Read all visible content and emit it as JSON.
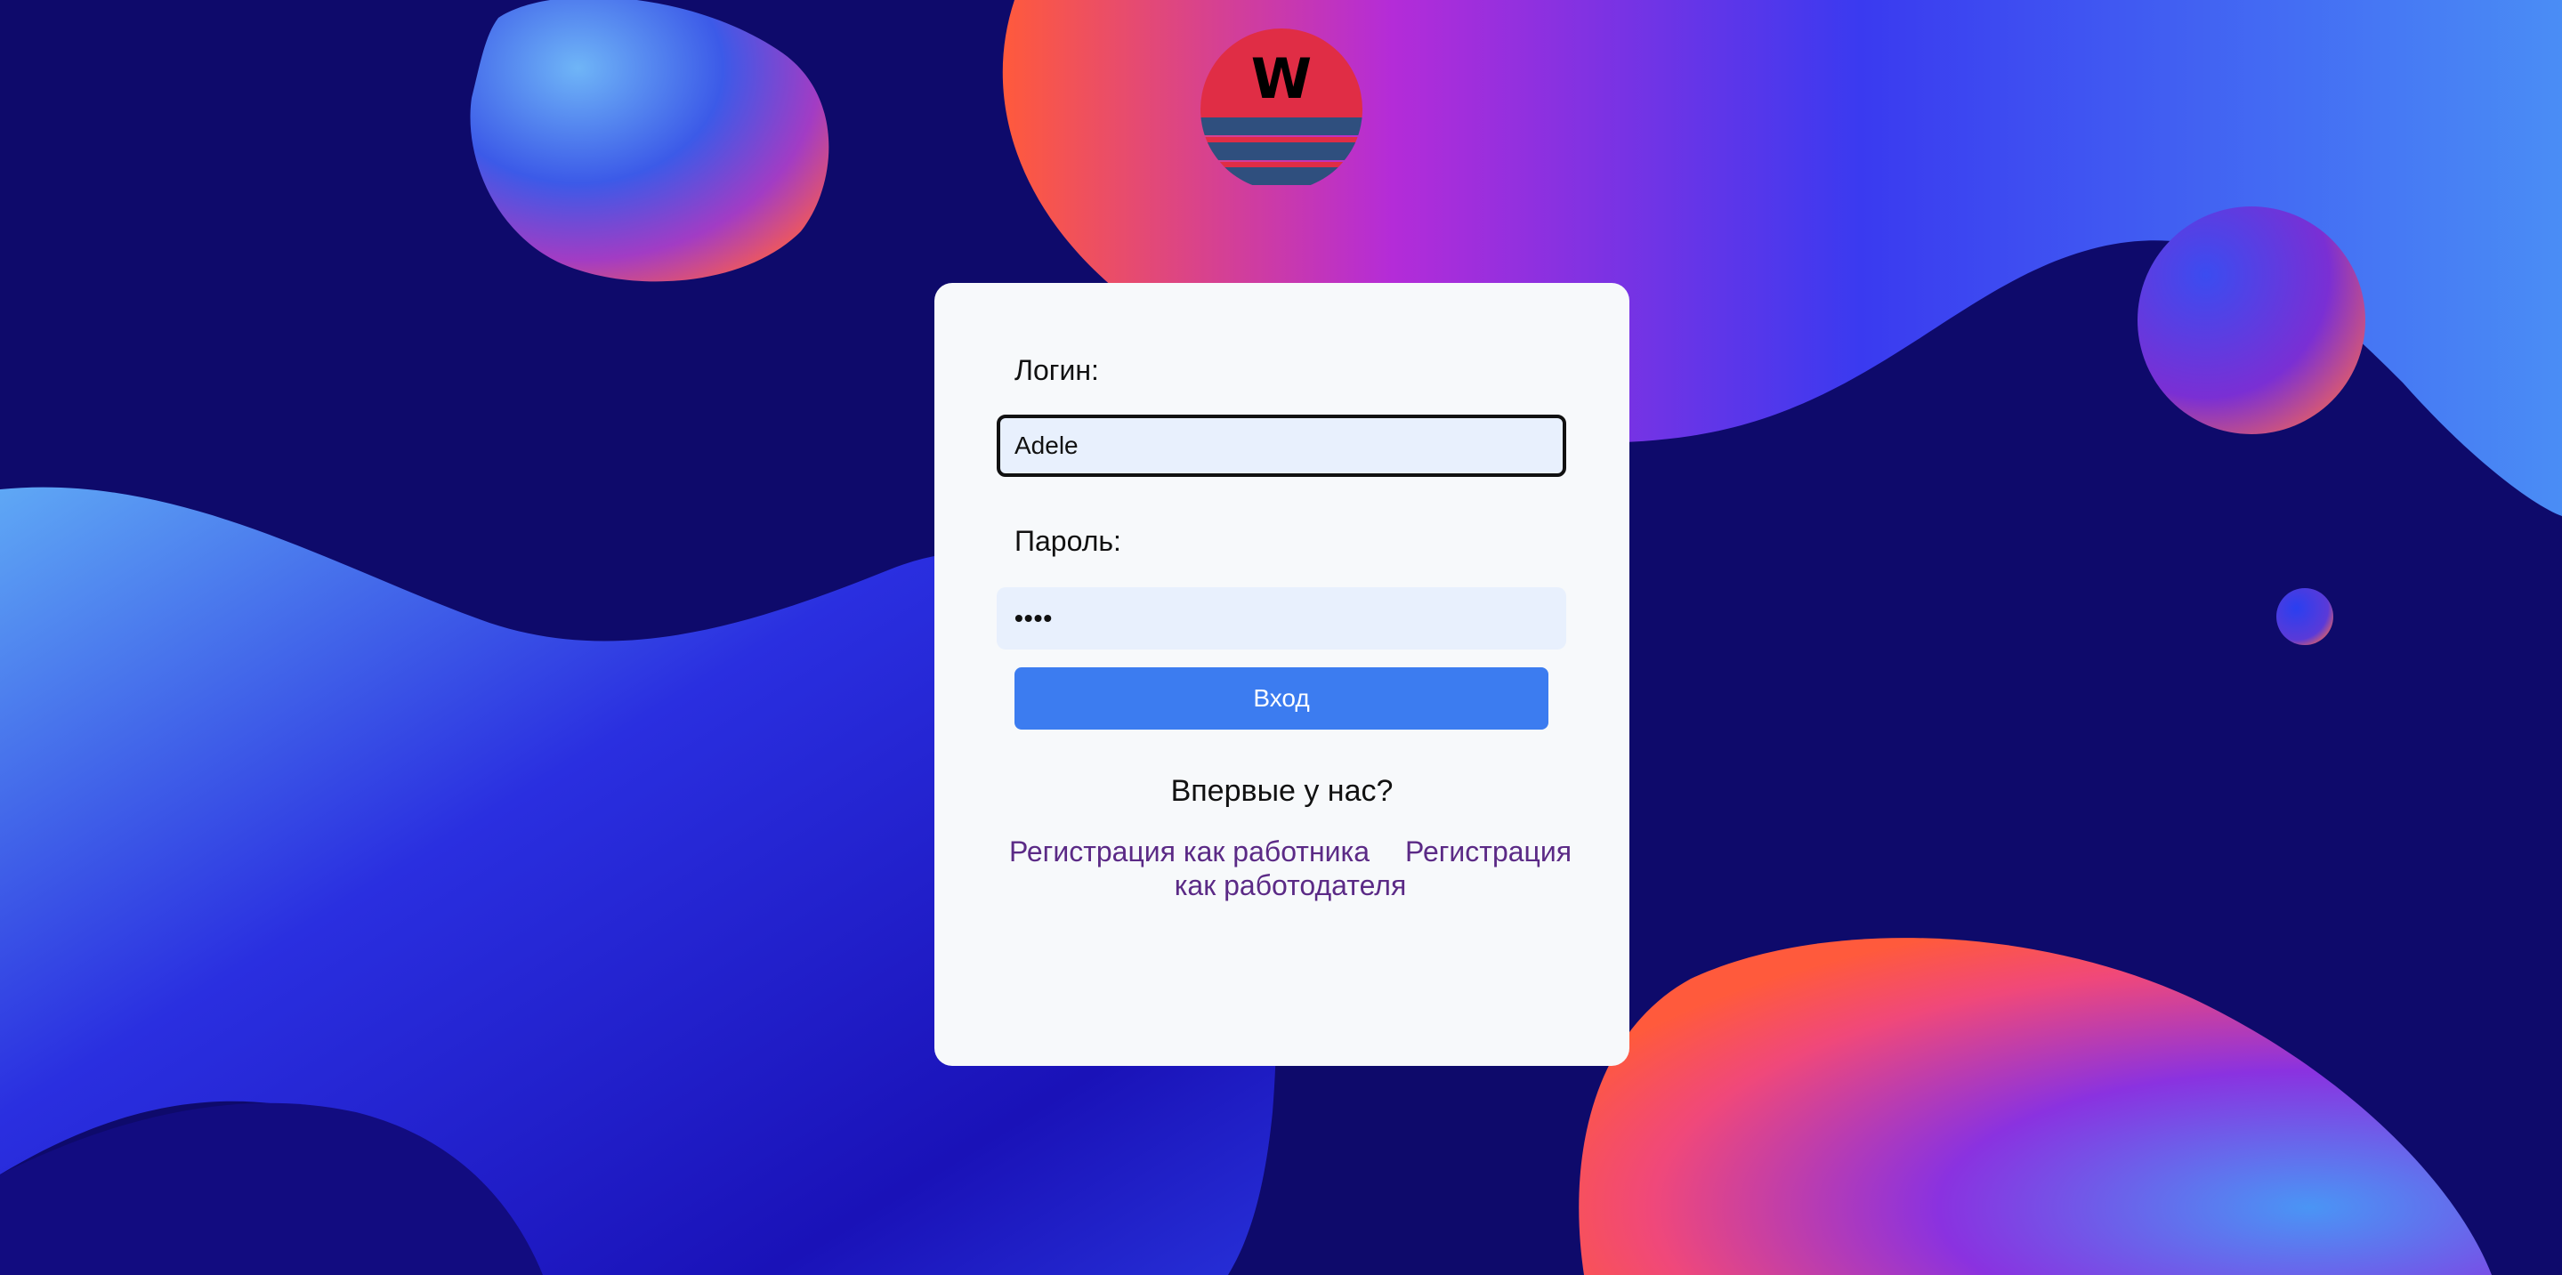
{
  "logo": {
    "letter": "W",
    "colors": {
      "top": "#e02d45",
      "stripes": "#2f4f7e",
      "text": "#000000"
    }
  },
  "form": {
    "login_label": "Логин:",
    "login_value": "Adele",
    "password_label": "Пароль:",
    "password_value": "••••",
    "submit_label": "Вход"
  },
  "register": {
    "prompt": "Впервые у нас?",
    "worker_link": "Регистрация как работника",
    "employer_link": "Регистрация как работодателя"
  },
  "colors": {
    "background": "#0e0a6b",
    "card": "#f7f9fb",
    "input": "#e8f0fd",
    "button": "#3c7cf0",
    "link": "#5b2a86"
  }
}
